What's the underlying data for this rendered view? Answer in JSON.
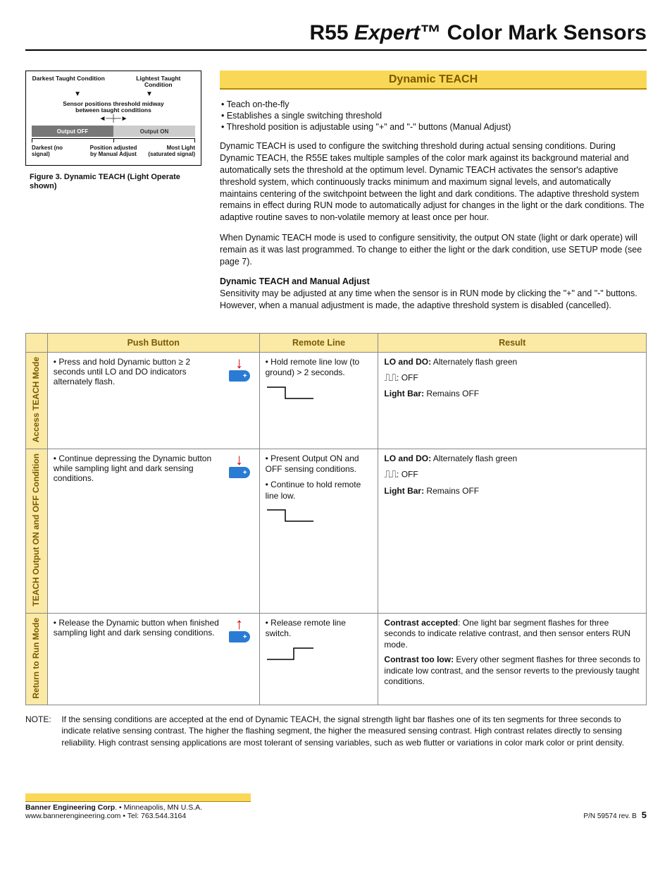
{
  "header": {
    "line": "R55 Expert™ Color Mark Sensors",
    "prefix": "R55 ",
    "italic": "Expert",
    "suffix": "™ Color Mark Sensors"
  },
  "section_title": "Dynamic TEACH",
  "bullets": [
    "• Teach on-the-fly",
    "• Establishes a single switching threshold",
    "• Threshold position is adjustable using  \"+\" and  \"-\" buttons (Manual Adjust)"
  ],
  "para1": "Dynamic TEACH is used to configure the switching threshold during actual sensing conditions. During Dynamic TEACH, the R55E takes multiple samples of the color mark against its background material and automatically sets the threshold at the optimum level. Dynamic TEACH activates the sensor's adaptive threshold system, which continuously tracks minimum and maximum signal levels, and automatically maintains centering of the switchpoint between the light and dark conditions. The adaptive threshold system remains in effect during RUN mode to automatically adjust for changes in the light or the dark conditions. The adaptive routine saves to non-volatile memory at least once per hour.",
  "para2": "When Dynamic TEACH mode is used to configure sensitivity, the output ON state (light or dark operate) will remain as it was last programmed. To change to either the light or the dark condition, use SETUP mode (see page 7).",
  "subhead": "Dynamic TEACH and Manual Adjust",
  "para3": "Sensitivity may be adjusted at any time when the sensor is in RUN mode by clicking the \"+\" and \"-\" buttons. However, when a manual adjustment is made, the adaptive threshold system is disabled (cancelled).",
  "figure": {
    "top_left": "Darkest Taught Condition",
    "top_right": "Lightest Taught Condition",
    "mid": "Sensor positions threshold midway between taught conditions",
    "off": "Output OFF",
    "on": "Output ON",
    "bot_left": "Darkest (no signal)",
    "bot_mid": "Position adjusted by Manual Adjust",
    "bot_right": "Most Light (saturated signal)",
    "caption": "Figure 3.  Dynamic TEACH (Light Operate shown)"
  },
  "table": {
    "headers": [
      "Push Button",
      "Remote Line",
      "Result"
    ],
    "rows": [
      {
        "label": "Access TEACH Mode",
        "push": "• Press and hold Dynamic button ≥ 2 seconds until LO and DO indicators alternately flash.",
        "remote": "• Hold remote line low (to ground) > 2 seconds.",
        "result_lodo": "LO and DO:",
        "result_lodo_txt": " Alternately flash green",
        "result_pulse": ": OFF",
        "result_bar_lbl": "Light Bar:",
        "result_bar_txt": " Remains OFF",
        "arrow": "down"
      },
      {
        "label": "TEACH Output ON and OFF Condition",
        "push": "• Continue depressing the Dynamic button while sampling light and dark sensing conditions.",
        "remote": "• Present Output ON and OFF sensing conditions.",
        "remote2": "• Continue to hold remote line low.",
        "result_lodo": "LO and DO:",
        "result_lodo_txt": " Alternately flash green",
        "result_pulse": ": OFF",
        "result_bar_lbl": "Light Bar:",
        "result_bar_txt": " Remains OFF",
        "arrow": "down"
      },
      {
        "label": "Return to Run Mode",
        "push": "• Release the Dynamic button when finished sampling light and dark sensing conditions.",
        "remote": "• Release remote line switch.",
        "result_a_lbl": "Contrast accepted",
        "result_a_txt": ": One light bar segment flashes for three seconds to indicate relative contrast, and then sensor enters RUN mode.",
        "result_b_lbl": "Contrast too low:",
        "result_b_txt": " Every other segment flashes for three seconds to indicate low contrast, and the sensor reverts to the previously taught conditions.",
        "arrow": "up"
      }
    ]
  },
  "note_label": "NOTE:",
  "note_text": "If the sensing conditions are accepted at the end of Dynamic TEACH, the signal strength light bar flashes one of its ten segments for three seconds to indicate relative sensing contrast. The higher the flashing segment, the higher the measured sensing contrast. High contrast relates directly to sensing reliability. High contrast sensing applications are most tolerant of sensing variables, such as web flutter or variations in color mark color or print density.",
  "footer": {
    "company": "Banner Engineering Corp",
    "loc": ". • Minneapolis, MN U.S.A.",
    "web": "www.bannerengineering.com  •  Tel: 763.544.3164",
    "pn": "P/N  59574 rev. B",
    "page": "5"
  }
}
